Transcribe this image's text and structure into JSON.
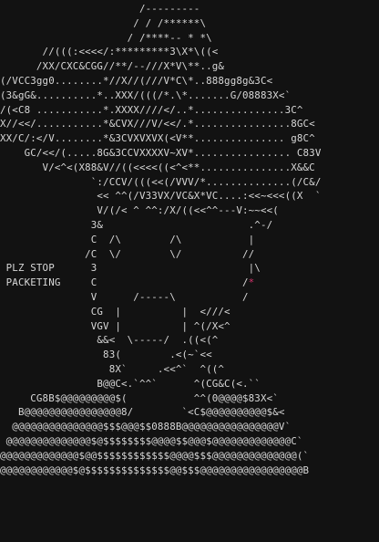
{
  "art": {
    "text_color": "#d8d8d8",
    "background_color": "#121212",
    "accent_color": "#d6336c",
    "lines": [
      "                       /---------",
      "                      / / /******\\",
      "                     / /****-- * *\\",
      "       //(((:<<<</:*********3\\X*\\((<",
      "      /XX/CXC&CGG//**/--///X*V\\**..g&",
      "(/VCC3gg0........*//X//(///V*C\\*..888gg8g&3C<",
      "(3&gG&..........*..XXX/(((/*.\\*.......G/08883X<`",
      "/(<C8 ...........*.XXXX////</..*...............3C^",
      "X//<</...........*&CVX///V/<</.*................8GC<",
      "XX/C/:</V........*&3CVXVXVX(<V**............... g8C^",
      "    GC/<</(.....8G&3CCVXXXXV~XV*................ C83V",
      "       V/<^<(X88&V//((<<<<((<^<**...............X&&C",
      "               `:/CCV/(((<<(/VVV/*..............(/C&/",
      "                << ^^(/V33VX/VC&X*VC....:<<~<<<((X  `",
      "                V/(/< ^ ^^:/X/((<<^^---V:~~<<(",
      "               3&                        .^-/",
      "               C  /\\        /\\           |",
      "              /C  \\/        \\/          //",
      " PLZ STOP      3                         |\\",
      " PACKETING     C                        /*",
      "               V      /-----\\           /",
      "               CG  |          |  <///<",
      "               VGV |          | ^(/X<^",
      "                &&<  \\-----/  .((<(^",
      "                 83(        .<(~`<<",
      "                  8X`     .<<^`  ^((^",
      "                B@@C<.`^^`      ^(CG&C(<.``",
      "     CG8B$@@@@@@@@@$(           ^^(0@@@@$83X<`",
      "   B@@@@@@@@@@@@@@@@8/        `<C$@@@@@@@@@@$&<",
      "  @@@@@@@@@@@@@@@$$$@@@$$0888B@@@@@@@@@@@@@@@@V`",
      " @@@@@@@@@@@@@@$@$$$$$$$$@@@@$$@@@$@@@@@@@@@@@@@C`",
      "@@@@@@@@@@@@@$@@$$$$$$$$$$$$@@@@$$$@@@@@@@@@@@@@@(`",
      "@@@@@@@@@@@@$@$$$$$$$$$$$$$$@@$$$@@@@@@@@@@@@@@@@@B"
    ]
  }
}
